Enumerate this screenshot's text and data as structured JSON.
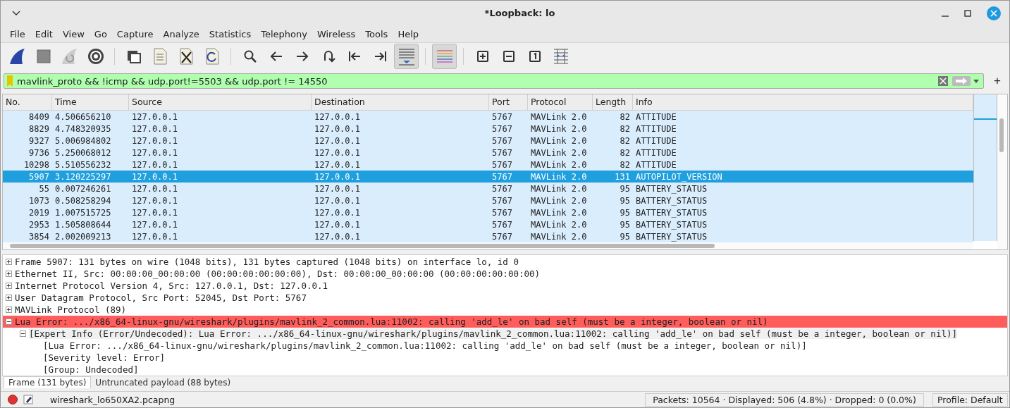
{
  "window": {
    "title": "*Loopback: lo"
  },
  "menu": [
    "File",
    "Edit",
    "View",
    "Go",
    "Capture",
    "Analyze",
    "Statistics",
    "Telephony",
    "Wireless",
    "Tools",
    "Help"
  ],
  "toolbar": [
    {
      "kind": "fin",
      "pressed": false
    },
    {
      "kind": "stop",
      "pressed": false
    },
    {
      "kind": "restart",
      "pressed": false
    },
    {
      "kind": "gear",
      "pressed": false
    },
    {
      "kind": "sep"
    },
    {
      "kind": "folder",
      "pressed": false
    },
    {
      "kind": "file",
      "pressed": false
    },
    {
      "kind": "closefile",
      "pressed": false
    },
    {
      "kind": "reload",
      "pressed": false
    },
    {
      "kind": "sep"
    },
    {
      "kind": "search",
      "pressed": false
    },
    {
      "kind": "left",
      "pressed": false
    },
    {
      "kind": "right",
      "pressed": false
    },
    {
      "kind": "jump",
      "pressed": false
    },
    {
      "kind": "first",
      "pressed": false
    },
    {
      "kind": "last",
      "pressed": false
    },
    {
      "kind": "autoscroll",
      "pressed": true
    },
    {
      "kind": "sep"
    },
    {
      "kind": "colorize",
      "pressed": true
    },
    {
      "kind": "sep"
    },
    {
      "kind": "zoomin",
      "pressed": false
    },
    {
      "kind": "zoomout",
      "pressed": false
    },
    {
      "kind": "normal",
      "pressed": false
    },
    {
      "kind": "resize",
      "pressed": false
    }
  ],
  "filter": {
    "value": "mavlink_proto && !icmp && udp.port!=5503 && udp.port != 14550"
  },
  "add_button": "+",
  "packet_list": {
    "columns": [
      "No.",
      "Time",
      "Source",
      "Destination",
      "Port",
      "Protocol",
      "Length",
      "Info"
    ],
    "rows": [
      {
        "cells": [
          "8409",
          "4.506656210",
          "127.0.0.1",
          "127.0.0.1",
          "5767",
          "MAVLink 2.0",
          "82",
          "ATTITUDE"
        ],
        "selected": false
      },
      {
        "cells": [
          "8829",
          "4.748320935",
          "127.0.0.1",
          "127.0.0.1",
          "5767",
          "MAVLink 2.0",
          "82",
          "ATTITUDE"
        ],
        "selected": false
      },
      {
        "cells": [
          "9327",
          "5.006984802",
          "127.0.0.1",
          "127.0.0.1",
          "5767",
          "MAVLink 2.0",
          "82",
          "ATTITUDE"
        ],
        "selected": false
      },
      {
        "cells": [
          "9736",
          "5.250068012",
          "127.0.0.1",
          "127.0.0.1",
          "5767",
          "MAVLink 2.0",
          "82",
          "ATTITUDE"
        ],
        "selected": false
      },
      {
        "cells": [
          "10298",
          "5.510556232",
          "127.0.0.1",
          "127.0.0.1",
          "5767",
          "MAVLink 2.0",
          "82",
          "ATTITUDE"
        ],
        "selected": false
      },
      {
        "cells": [
          "5907",
          "3.120225297",
          "127.0.0.1",
          "127.0.0.1",
          "5767",
          "MAVLink 2.0",
          "131",
          "AUTOPILOT_VERSION"
        ],
        "selected": true
      },
      {
        "cells": [
          "55",
          "0.007246261",
          "127.0.0.1",
          "127.0.0.1",
          "5767",
          "MAVLink 2.0",
          "95",
          "BATTERY_STATUS"
        ],
        "selected": false
      },
      {
        "cells": [
          "1073",
          "0.508258294",
          "127.0.0.1",
          "127.0.0.1",
          "5767",
          "MAVLink 2.0",
          "95",
          "BATTERY_STATUS"
        ],
        "selected": false
      },
      {
        "cells": [
          "2019",
          "1.007515725",
          "127.0.0.1",
          "127.0.0.1",
          "5767",
          "MAVLink 2.0",
          "95",
          "BATTERY_STATUS"
        ],
        "selected": false
      },
      {
        "cells": [
          "2953",
          "1.505808644",
          "127.0.0.1",
          "127.0.0.1",
          "5767",
          "MAVLink 2.0",
          "95",
          "BATTERY_STATUS"
        ],
        "selected": false
      },
      {
        "cells": [
          "3854",
          "2.002009213",
          "127.0.0.1",
          "127.0.0.1",
          "5767",
          "MAVLink 2.0",
          "95",
          "BATTERY_STATUS"
        ],
        "selected": false
      }
    ]
  },
  "details": [
    {
      "text": "Frame 5907: 131 bytes on wire (1048 bits), 131 bytes captured (1048 bits) on interface lo, id 0",
      "expanded": false
    },
    {
      "text": "Ethernet II, Src: 00:00:00_00:00:00 (00:00:00:00:00:00), Dst: 00:00:00_00:00:00 (00:00:00:00:00:00)",
      "expanded": false
    },
    {
      "text": "Internet Protocol Version 4, Src: 127.0.0.1, Dst: 127.0.0.1",
      "expanded": false
    },
    {
      "text": "User Datagram Protocol, Src Port: 52045, Dst Port: 5767",
      "expanded": false
    },
    {
      "text": "MAVLink Protocol (89)",
      "expanded": false
    },
    {
      "text": "Lua Error: .../x86_64-linux-gnu/wireshark/plugins/mavlink_2_common.lua:11002: calling 'add_le' on bad self (must be a integer, boolean or nil)",
      "kind": "error",
      "expanded": true,
      "children": [
        {
          "text": "[Expert Info (Error/Undecoded): Lua Error: .../x86_64-linux-gnu/wireshark/plugins/mavlink_2_common.lua:11002: calling 'add_le' on bad self (must be a integer, boolean or nil)]",
          "kind": "expert",
          "expanded": true,
          "children": [
            {
              "text": "[Lua Error: .../x86_64-linux-gnu/wireshark/plugins/mavlink_2_common.lua:11002: calling 'add_le' on bad self (must be a integer, boolean or nil)]"
            },
            {
              "text": "[Severity level: Error]"
            },
            {
              "text": "[Group: Undecoded]"
            }
          ]
        }
      ]
    }
  ],
  "byte_tabs": [
    {
      "label": "Frame (131 bytes)",
      "selected": true
    },
    {
      "label": "Untruncated payload (88 bytes)",
      "selected": false
    }
  ],
  "status_bar": {
    "file": "wireshark_lo650XA2.pcapng",
    "stats": "Packets: 10564 · Displayed: 506 (4.8%) · Dropped: 0 (0.0%)",
    "profile": "Profile: Default"
  }
}
